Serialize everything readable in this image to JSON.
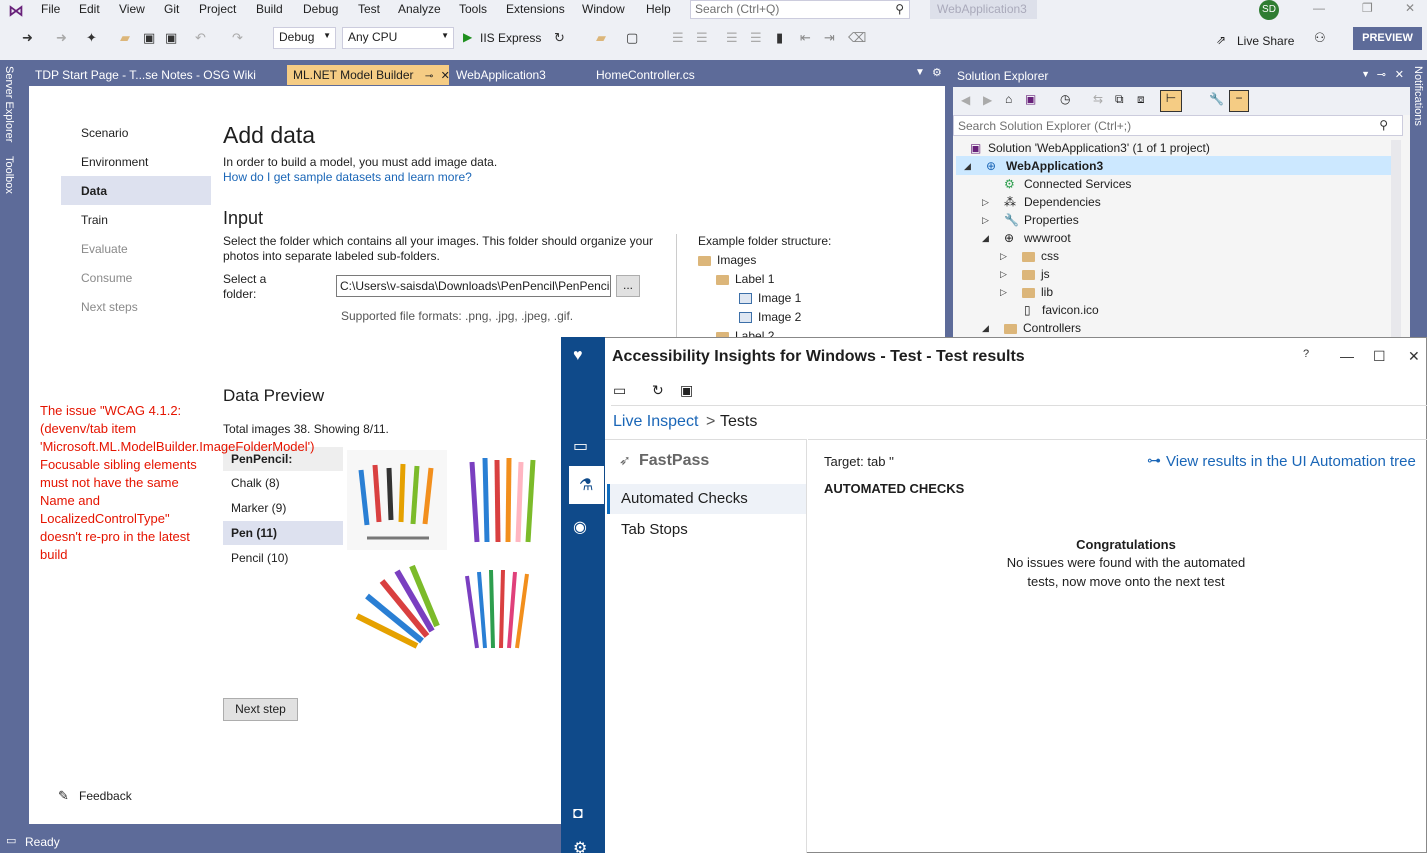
{
  "menubar": {
    "items": [
      "File",
      "Edit",
      "View",
      "Git",
      "Project",
      "Build",
      "Debug",
      "Test",
      "Analyze",
      "Tools",
      "Extensions",
      "Window",
      "Help"
    ],
    "search_placeholder": "Search (Ctrl+Q)",
    "solution_name": "WebApplication3",
    "avatar_initials": "SD"
  },
  "toolbar": {
    "config": "Debug",
    "platform": "Any CPU",
    "run_target": "IIS Express",
    "live_share": "Live Share",
    "preview": "PREVIEW"
  },
  "side_tool_windows": {
    "left": [
      "Server Explorer",
      "Toolbox"
    ],
    "right": [
      "Notifications"
    ]
  },
  "tabs": [
    {
      "label": "TDP Start Page - T...se Notes - OSG Wiki"
    },
    {
      "label": "ML.NET Model Builder",
      "active": true
    },
    {
      "label": "WebApplication3"
    },
    {
      "label": "HomeController.cs"
    }
  ],
  "model_builder": {
    "nav": [
      "Scenario",
      "Environment",
      "Data",
      "Train",
      "Evaluate",
      "Consume",
      "Next steps"
    ],
    "title": "Add data",
    "intro": "In order to build a model, you must add image data.",
    "sample_link": "How do I get sample datasets and learn more?",
    "input_heading": "Input",
    "input_desc": "Select the folder which contains all your images. This folder should organize your photos into separate labeled sub-folders.",
    "folder_label": "Select a folder:",
    "folder_value": "C:\\Users\\v-saisda\\Downloads\\PenPencil\\PenPencil",
    "browse_label": "...",
    "formats": "Supported file formats: .png, .jpg, .jpeg, .gif.",
    "example_heading": "Example folder structure:",
    "example_tree": [
      "Images",
      "Label 1",
      "Image 1",
      "Image 2",
      "Label 2"
    ],
    "preview_heading": "Data Preview",
    "preview_summary": "Total images 38. Showing 8/11.",
    "categories": [
      {
        "label": "PenPencil:",
        "selected": false
      },
      {
        "label": "Chalk (8)",
        "selected": false
      },
      {
        "label": "Marker (9)",
        "selected": false
      },
      {
        "label": "Pen (11)",
        "selected": true
      },
      {
        "label": "Pencil (10)",
        "selected": false
      }
    ],
    "next_step": "Next step",
    "feedback": "Feedback"
  },
  "note": "The issue \"WCAG 4.1.2: (devenv/tab item 'Microsoft.ML.ModelBuilder.ImageFolderModel') Focusable sibling elements must not have the same Name and LocalizedControlType\" doesn't re-pro in the latest build",
  "status": {
    "text": "Ready"
  },
  "solution_explorer": {
    "title": "Solution Explorer",
    "search_placeholder": "Search Solution Explorer (Ctrl+;)",
    "tree": [
      {
        "label": "Solution 'WebApplication3' (1 of 1 project)"
      },
      {
        "label": "WebApplication3"
      },
      {
        "label": "Connected Services"
      },
      {
        "label": "Dependencies"
      },
      {
        "label": "Properties"
      },
      {
        "label": "wwwroot"
      },
      {
        "label": "css"
      },
      {
        "label": "js"
      },
      {
        "label": "lib"
      },
      {
        "label": "favicon.ico"
      },
      {
        "label": "Controllers"
      }
    ]
  },
  "accessibility_insights": {
    "title": "Accessibility Insights for Windows - Test - Test results",
    "breadcrumb_link": "Live Inspect",
    "breadcrumb_sep": ">",
    "breadcrumb_current": "Tests",
    "fastpass": "FastPass",
    "menu": [
      "Automated Checks",
      "Tab Stops"
    ],
    "target": "Target: tab ''",
    "view_results": "View results in the UI Automation tree",
    "section": "AUTOMATED CHECKS",
    "congrats_title": "Congratulations",
    "congrats_msg": "No issues were found with the automated tests, now move onto the next test"
  }
}
